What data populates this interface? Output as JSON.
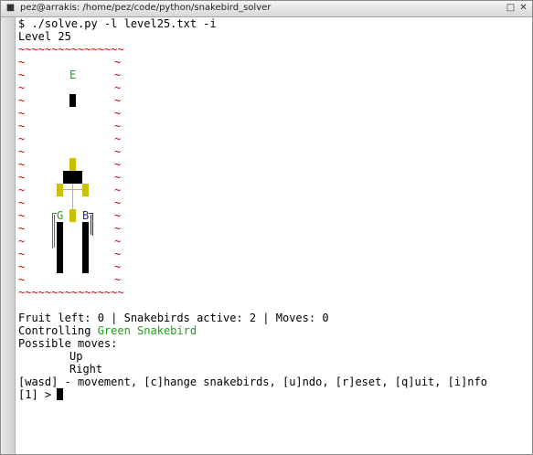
{
  "window": {
    "title": "pez@arrakis: /home/pez/code/python/snakebird_solver",
    "menu_icon": "app-menu-icon",
    "maximize_icon": "maximize-icon",
    "close_icon": "close-icon"
  },
  "terminal": {
    "command": "$ ./solve.py -l level25.txt -i",
    "level": "Level 25",
    "border_top": "~~~~~~~~~~~~~~~~",
    "border_bottom": "~~~~~~~~~~~~~~~~",
    "border_left": "~",
    "border_right": "~",
    "exit_char": "E",
    "green_head": "G",
    "blue_head": "B",
    "status_line": "Fruit left: 0 | Snakebirds active: 2 | Moves: 0",
    "controlling_label": "Controlling ",
    "controlling_value": "Green Snakebird",
    "possible_moves_label": "Possible moves:",
    "moves": [
      "Up",
      "Right"
    ],
    "help": "[wasd] - movement, [c]hange snakebirds, [u]ndo, [r]eset, [q]uit, [i]nfo",
    "prompt": "[1] > "
  },
  "colors": {
    "border": "#d00000",
    "green_snakebird": "#1fa01f",
    "blue_snakebird": "#2020b0",
    "yellow_spikes": "#c8c000"
  }
}
